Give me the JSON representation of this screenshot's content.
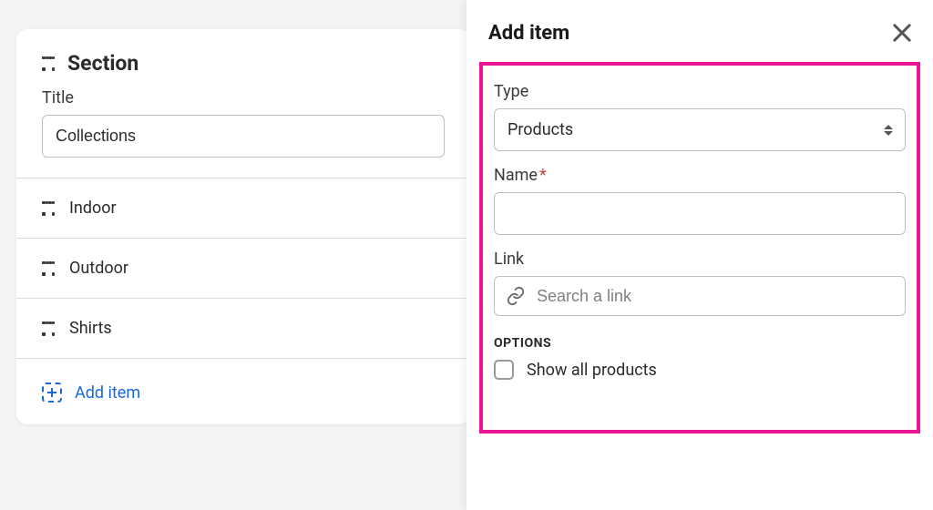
{
  "section": {
    "heading": "Section",
    "title_label": "Title",
    "title_value": "Collections",
    "items": [
      "Indoor",
      "Outdoor",
      "Shirts"
    ],
    "add_item_label": "Add item"
  },
  "panel": {
    "title": "Add item",
    "type_label": "Type",
    "type_value": "Products",
    "name_label": "Name",
    "link_label": "Link",
    "link_placeholder": "Search a link",
    "options_label": "OPTIONS",
    "show_all_label": "Show all products"
  }
}
